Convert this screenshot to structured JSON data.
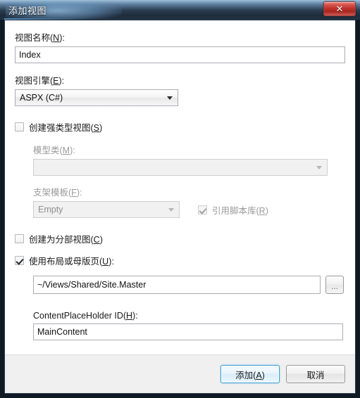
{
  "window": {
    "title": "添加视图",
    "close_label": "✕"
  },
  "form": {
    "view_name": {
      "label": "视图名称(N):",
      "accel": "N",
      "value": "Index"
    },
    "view_engine": {
      "label": "视图引擎(E):",
      "accel": "E",
      "value": "ASPX (C#)"
    },
    "strongly_typed": {
      "label": "创建强类型视图(S)",
      "accel": "S",
      "checked": false
    },
    "model_class": {
      "label": "模型类(M):",
      "accel": "M",
      "value": "",
      "enabled": false
    },
    "scaffold_template": {
      "label": "支架模板(F):",
      "accel": "F",
      "value": "Empty",
      "enabled": false
    },
    "reference_script_libraries": {
      "label": "引用脚本库(R)",
      "accel": "R",
      "checked": true,
      "enabled": false
    },
    "partial_view": {
      "label": "创建为分部视图(C)",
      "accel": "C",
      "checked": false
    },
    "use_layout": {
      "label": "使用布局或母版页(U):",
      "accel": "U",
      "checked": true
    },
    "layout_path": {
      "value": "~/Views/Shared/Site.Master",
      "browse_label": "..."
    },
    "content_placeholder": {
      "label": "ContentPlaceHolder ID(H):",
      "accel": "H",
      "value": "MainContent"
    }
  },
  "footer": {
    "add_label": "添加(A)",
    "cancel_label": "取消"
  },
  "colors": {
    "accent": "#3c9ed4",
    "close_red": "#bb2d26",
    "panel": "#ffffff",
    "footer": "#f0f0f0"
  }
}
